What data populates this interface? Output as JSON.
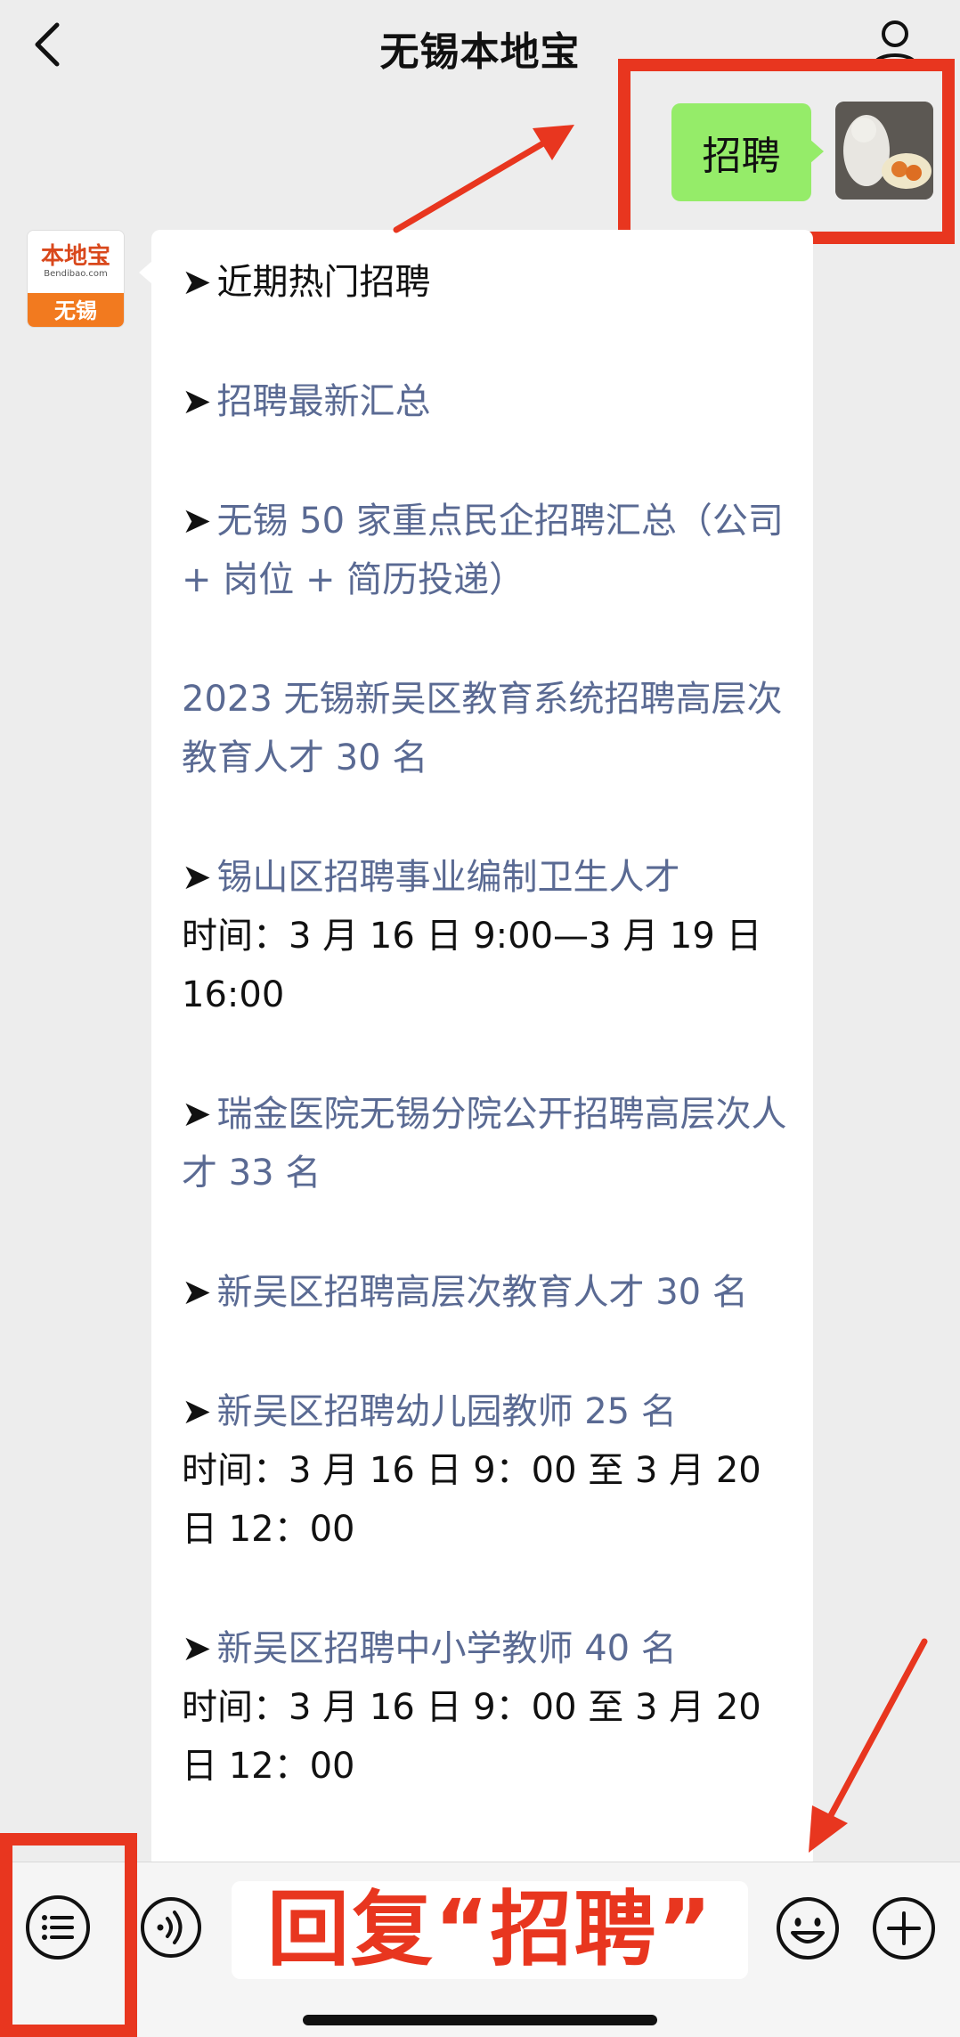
{
  "header": {
    "title": "无锡本地宝"
  },
  "outgoing": {
    "text": "招聘"
  },
  "brand_avatar": {
    "logo": "本地宝",
    "sub": "Bendibao.com",
    "city": "无锡"
  },
  "messages": [
    {
      "arrow": "➤",
      "text": "近期热门招聘",
      "style": "plain"
    },
    {
      "arrow": "➤",
      "text": "招聘最新汇总",
      "style": "link"
    },
    {
      "arrow": "➤",
      "text": "无锡 50 家重点民企招聘汇总（公司 + 岗位 + 简历投递）",
      "style": "link"
    },
    {
      "arrow": "",
      "text": "2023 无锡新吴区教育系统招聘高层次教育人才 30 名",
      "style": "link"
    },
    {
      "arrow": "➤",
      "text": "锡山区招聘事业编制卫生人才",
      "style": "link",
      "time": "时间：3 月 16 日 9:00—3 月 19 日 16:00"
    },
    {
      "arrow": "➤",
      "text": "瑞金医院无锡分院公开招聘高层次人才 33 名",
      "style": "link"
    },
    {
      "arrow": "➤",
      "text": "新吴区招聘高层次教育人才 30 名",
      "style": "link"
    },
    {
      "arrow": "➤",
      "text": "新吴区招聘幼儿园教师 25 名",
      "style": "link",
      "time": "时间：3 月 16 日 9：00 至 3 月 20 日 12：00"
    },
    {
      "arrow": "➤",
      "text": "新吴区招聘中小学教师 40 名",
      "style": "link",
      "time": "时间：3 月 16 日 9：00 至 3 月 20 日 12：00"
    }
  ],
  "input": {
    "hint": "回复“招聘”"
  },
  "icons": {
    "back": "chevron-left-icon",
    "profile": "person-icon",
    "menu": "list-icon",
    "voice": "voice-icon",
    "emoji": "emoji-icon",
    "plus": "plus-icon"
  },
  "colors": {
    "bubble_out": "#95ec69",
    "link": "#5a6a93",
    "annotation": "#e8361f",
    "background": "#ededed"
  }
}
